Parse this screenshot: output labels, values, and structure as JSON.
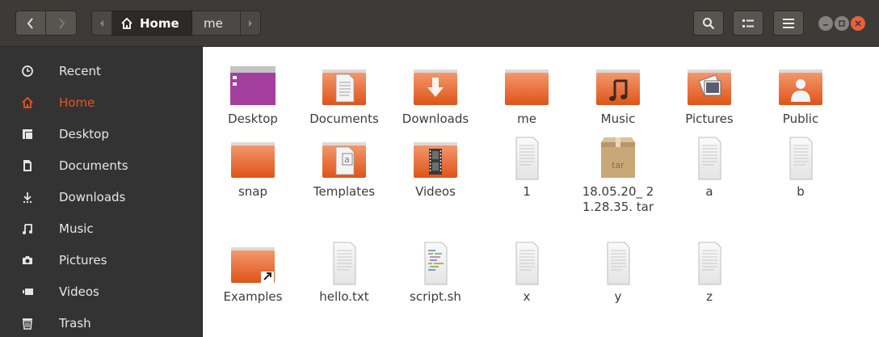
{
  "header": {
    "path": {
      "home_label": "Home",
      "current_label": "me"
    }
  },
  "sidebar": {
    "items": [
      {
        "label": "Recent",
        "icon": "clock-icon"
      },
      {
        "label": "Home",
        "icon": "home-icon",
        "active": true
      },
      {
        "label": "Desktop",
        "icon": "desktop-folder-icon"
      },
      {
        "label": "Documents",
        "icon": "document-icon"
      },
      {
        "label": "Downloads",
        "icon": "download-icon"
      },
      {
        "label": "Music",
        "icon": "music-note-icon"
      },
      {
        "label": "Pictures",
        "icon": "camera-icon"
      },
      {
        "label": "Videos",
        "icon": "video-icon"
      },
      {
        "label": "Trash",
        "icon": "trash-icon"
      }
    ]
  },
  "files": [
    {
      "name": "Desktop",
      "type": "desktop-folder"
    },
    {
      "name": "Documents",
      "type": "documents-folder"
    },
    {
      "name": "Downloads",
      "type": "downloads-folder"
    },
    {
      "name": "me",
      "type": "folder"
    },
    {
      "name": "Music",
      "type": "music-folder"
    },
    {
      "name": "Pictures",
      "type": "pictures-folder"
    },
    {
      "name": "Public",
      "type": "public-folder"
    },
    {
      "name": "snap",
      "type": "folder"
    },
    {
      "name": "Templates",
      "type": "templates-folder"
    },
    {
      "name": "Videos",
      "type": "videos-folder"
    },
    {
      "name": "1",
      "type": "text-file"
    },
    {
      "name": "18.05.20_ 21.28.35. tar",
      "type": "tar-archive",
      "badge": "tar"
    },
    {
      "name": "a",
      "type": "text-file"
    },
    {
      "name": "b",
      "type": "text-file"
    },
    {
      "name": "Examples",
      "type": "link-folder"
    },
    {
      "name": "hello.txt",
      "type": "text-file"
    },
    {
      "name": "script.sh",
      "type": "script-file"
    },
    {
      "name": "x",
      "type": "text-file"
    },
    {
      "name": "y",
      "type": "text-file"
    },
    {
      "name": "z",
      "type": "text-file"
    }
  ],
  "colors": {
    "accent": "#e95420",
    "headerbar": "#3c3b37",
    "sidebar": "#333333",
    "folder_top": "#f08a5d",
    "folder_bottom": "#e25a1e"
  }
}
